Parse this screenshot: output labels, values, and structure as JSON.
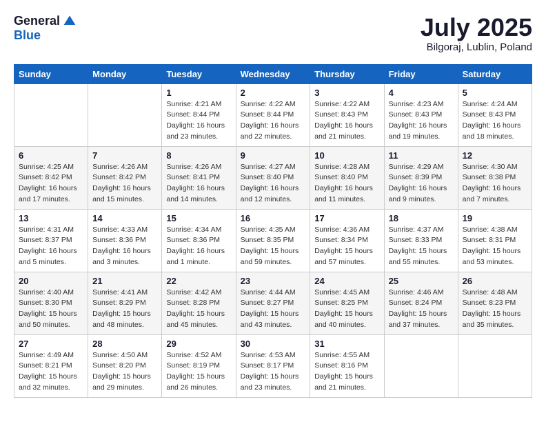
{
  "header": {
    "logo_general": "General",
    "logo_blue": "Blue",
    "month": "July 2025",
    "location": "Bilgoraj, Lublin, Poland"
  },
  "weekdays": [
    "Sunday",
    "Monday",
    "Tuesday",
    "Wednesday",
    "Thursday",
    "Friday",
    "Saturday"
  ],
  "weeks": [
    [
      {
        "day": "",
        "info": ""
      },
      {
        "day": "",
        "info": ""
      },
      {
        "day": "1",
        "info": "Sunrise: 4:21 AM\nSunset: 8:44 PM\nDaylight: 16 hours\nand 23 minutes."
      },
      {
        "day": "2",
        "info": "Sunrise: 4:22 AM\nSunset: 8:44 PM\nDaylight: 16 hours\nand 22 minutes."
      },
      {
        "day": "3",
        "info": "Sunrise: 4:22 AM\nSunset: 8:43 PM\nDaylight: 16 hours\nand 21 minutes."
      },
      {
        "day": "4",
        "info": "Sunrise: 4:23 AM\nSunset: 8:43 PM\nDaylight: 16 hours\nand 19 minutes."
      },
      {
        "day": "5",
        "info": "Sunrise: 4:24 AM\nSunset: 8:43 PM\nDaylight: 16 hours\nand 18 minutes."
      }
    ],
    [
      {
        "day": "6",
        "info": "Sunrise: 4:25 AM\nSunset: 8:42 PM\nDaylight: 16 hours\nand 17 minutes."
      },
      {
        "day": "7",
        "info": "Sunrise: 4:26 AM\nSunset: 8:42 PM\nDaylight: 16 hours\nand 15 minutes."
      },
      {
        "day": "8",
        "info": "Sunrise: 4:26 AM\nSunset: 8:41 PM\nDaylight: 16 hours\nand 14 minutes."
      },
      {
        "day": "9",
        "info": "Sunrise: 4:27 AM\nSunset: 8:40 PM\nDaylight: 16 hours\nand 12 minutes."
      },
      {
        "day": "10",
        "info": "Sunrise: 4:28 AM\nSunset: 8:40 PM\nDaylight: 16 hours\nand 11 minutes."
      },
      {
        "day": "11",
        "info": "Sunrise: 4:29 AM\nSunset: 8:39 PM\nDaylight: 16 hours\nand 9 minutes."
      },
      {
        "day": "12",
        "info": "Sunrise: 4:30 AM\nSunset: 8:38 PM\nDaylight: 16 hours\nand 7 minutes."
      }
    ],
    [
      {
        "day": "13",
        "info": "Sunrise: 4:31 AM\nSunset: 8:37 PM\nDaylight: 16 hours\nand 5 minutes."
      },
      {
        "day": "14",
        "info": "Sunrise: 4:33 AM\nSunset: 8:36 PM\nDaylight: 16 hours\nand 3 minutes."
      },
      {
        "day": "15",
        "info": "Sunrise: 4:34 AM\nSunset: 8:36 PM\nDaylight: 16 hours\nand 1 minute."
      },
      {
        "day": "16",
        "info": "Sunrise: 4:35 AM\nSunset: 8:35 PM\nDaylight: 15 hours\nand 59 minutes."
      },
      {
        "day": "17",
        "info": "Sunrise: 4:36 AM\nSunset: 8:34 PM\nDaylight: 15 hours\nand 57 minutes."
      },
      {
        "day": "18",
        "info": "Sunrise: 4:37 AM\nSunset: 8:33 PM\nDaylight: 15 hours\nand 55 minutes."
      },
      {
        "day": "19",
        "info": "Sunrise: 4:38 AM\nSunset: 8:31 PM\nDaylight: 15 hours\nand 53 minutes."
      }
    ],
    [
      {
        "day": "20",
        "info": "Sunrise: 4:40 AM\nSunset: 8:30 PM\nDaylight: 15 hours\nand 50 minutes."
      },
      {
        "day": "21",
        "info": "Sunrise: 4:41 AM\nSunset: 8:29 PM\nDaylight: 15 hours\nand 48 minutes."
      },
      {
        "day": "22",
        "info": "Sunrise: 4:42 AM\nSunset: 8:28 PM\nDaylight: 15 hours\nand 45 minutes."
      },
      {
        "day": "23",
        "info": "Sunrise: 4:44 AM\nSunset: 8:27 PM\nDaylight: 15 hours\nand 43 minutes."
      },
      {
        "day": "24",
        "info": "Sunrise: 4:45 AM\nSunset: 8:25 PM\nDaylight: 15 hours\nand 40 minutes."
      },
      {
        "day": "25",
        "info": "Sunrise: 4:46 AM\nSunset: 8:24 PM\nDaylight: 15 hours\nand 37 minutes."
      },
      {
        "day": "26",
        "info": "Sunrise: 4:48 AM\nSunset: 8:23 PM\nDaylight: 15 hours\nand 35 minutes."
      }
    ],
    [
      {
        "day": "27",
        "info": "Sunrise: 4:49 AM\nSunset: 8:21 PM\nDaylight: 15 hours\nand 32 minutes."
      },
      {
        "day": "28",
        "info": "Sunrise: 4:50 AM\nSunset: 8:20 PM\nDaylight: 15 hours\nand 29 minutes."
      },
      {
        "day": "29",
        "info": "Sunrise: 4:52 AM\nSunset: 8:19 PM\nDaylight: 15 hours\nand 26 minutes."
      },
      {
        "day": "30",
        "info": "Sunrise: 4:53 AM\nSunset: 8:17 PM\nDaylight: 15 hours\nand 23 minutes."
      },
      {
        "day": "31",
        "info": "Sunrise: 4:55 AM\nSunset: 8:16 PM\nDaylight: 15 hours\nand 21 minutes."
      },
      {
        "day": "",
        "info": ""
      },
      {
        "day": "",
        "info": ""
      }
    ]
  ]
}
